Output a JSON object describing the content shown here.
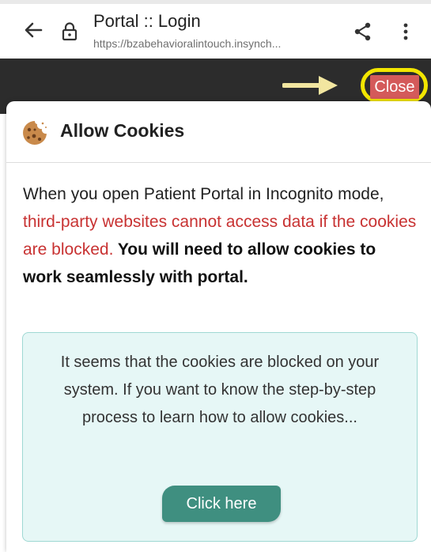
{
  "browser": {
    "title": "Portal :: Login",
    "url": "https://bzabehavioralintouch.insynch..."
  },
  "overlay": {
    "close_label": "Close"
  },
  "modal": {
    "title": "Allow Cookies",
    "intro": "When you open Patient Portal in Incognito mode, ",
    "warning": "third-party websites cannot access data if the cookies are blocked.",
    "emphasis": " You will need to allow cookies to work seamlessly with portal.",
    "info": "It seems that the cookies are blocked on your system. If you want to know the step-by-step process to learn how to allow cookies...",
    "button_label": "Click here"
  },
  "colors": {
    "close_bg": "#d45a5a",
    "highlight": "#f2e600",
    "warning_text": "#c83232",
    "info_bg": "#e6f7f6",
    "button_bg": "#3f8f80"
  }
}
